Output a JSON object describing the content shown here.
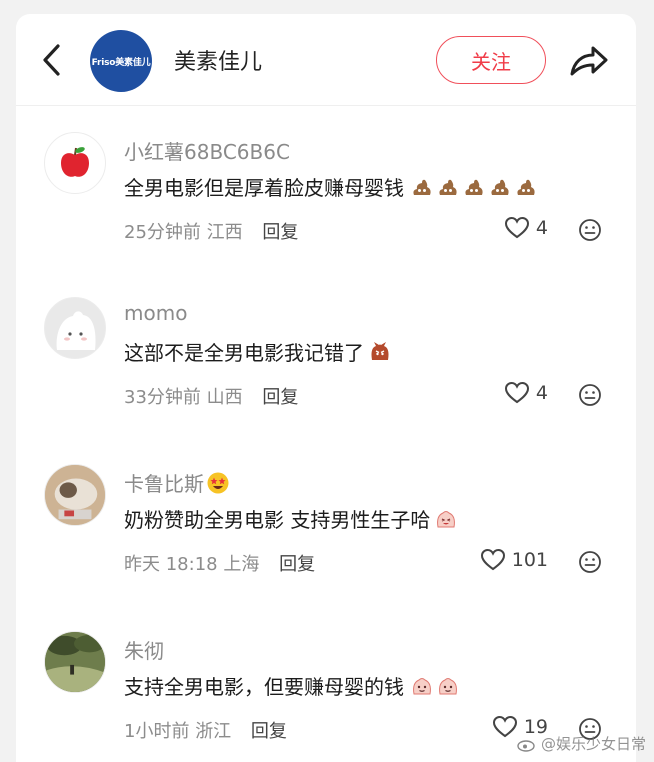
{
  "header": {
    "account_name": "美素佳儿",
    "logo_text": "Friso美素佳儿",
    "follow_label": "关注"
  },
  "comments": [
    {
      "username": "小红薯68BC6B6C",
      "text": "全男电影但是厚着脸皮赚母婴钱",
      "emoji_name": "poop-emoji",
      "emoji_count": 5,
      "time": "25分钟前",
      "location": "江西",
      "reply_label": "回复",
      "likes": "4"
    },
    {
      "username": "momo",
      "text": "这部不是全男电影我记错了",
      "emoji_name": "angry-face-emoji",
      "emoji_count": 1,
      "time": "33分钟前",
      "location": "山西",
      "reply_label": "回复",
      "likes": "4"
    },
    {
      "username": "卡鲁比斯",
      "name_emoji": "star-struck-emoji",
      "text": "奶粉赞助全男电影 支持男性生子哈",
      "emoji_name": "laughing-emoji",
      "emoji_count": 1,
      "time": "昨天 18:18",
      "location": "上海",
      "reply_label": "回复",
      "likes": "101"
    },
    {
      "username": "朱彻",
      "text": "支持全男电影，但要赚母婴的钱",
      "emoji_name": "smirk-emoji",
      "emoji_count": 2,
      "time": "1小时前",
      "location": "浙江",
      "reply_label": "回复",
      "likes": "19"
    }
  ],
  "watermark": "@娱乐少女日常",
  "colors": {
    "accent": "#f03c48",
    "brand_logo": "#1f4fa1",
    "meta_text": "#8c8c8c"
  }
}
